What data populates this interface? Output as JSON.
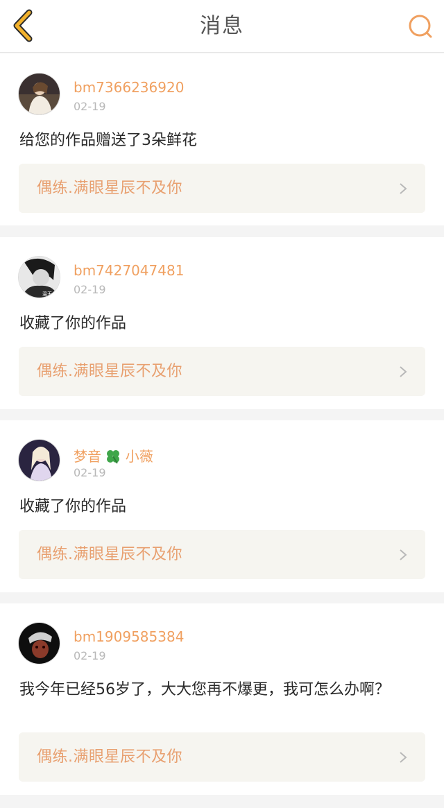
{
  "header": {
    "title": "消息"
  },
  "messages": [
    {
      "username": "bm7366236920",
      "date": "02-19",
      "text": "给您的作品赠送了3朵鲜花",
      "work_title": "偶练.满眼星辰不及你"
    },
    {
      "username": "bm7427047481",
      "date": "02-19",
      "text": "收藏了你的作品",
      "work_title": "偶练.满眼星辰不及你"
    },
    {
      "username_prefix": "梦音",
      "username_suffix": "小薇",
      "date": "02-19",
      "text": "收藏了你的作品",
      "work_title": "偶练.满眼星辰不及你"
    },
    {
      "username": "bm1909585384",
      "date": "02-19",
      "text": "我今年已经56岁了，大大您再不爆更，我可怎么办啊？",
      "work_title": "偶练.满眼星辰不及你"
    }
  ],
  "colors": {
    "accent": "#f0a060",
    "link_text": "#e8a070",
    "icon_back": "#f2b12b",
    "link_bg": "#f6f5f0"
  },
  "icons": {
    "back": "chevron-left-icon",
    "search": "search-icon",
    "clover": "four-leaf-clover-icon",
    "row_arrow": "chevron-right-icon"
  }
}
